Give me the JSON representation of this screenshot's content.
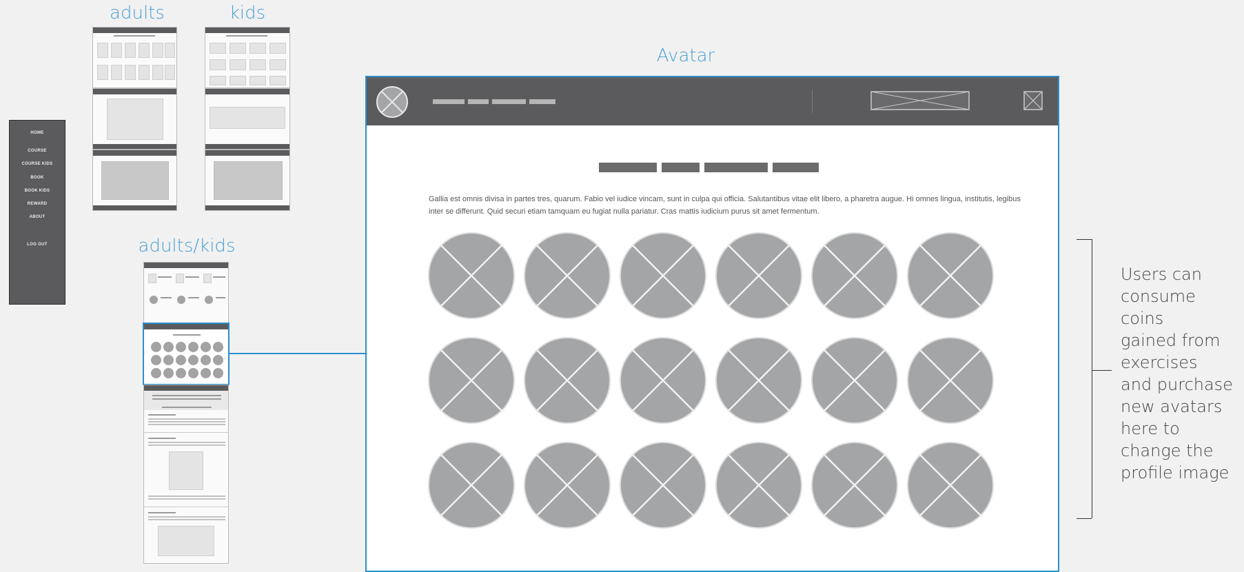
{
  "labels": {
    "adults": "adults",
    "kids": "kids",
    "adults_kids": "adults/kids",
    "avatar": "Avatar"
  },
  "side_menu": {
    "items": [
      "HOME",
      "COURSE",
      "COURSE KIDS",
      "BOOK",
      "BOOK KIDS",
      "REWARD",
      "ABOUT",
      "LOG OUT"
    ]
  },
  "avatar_page": {
    "paragraph": "Gallia est omnis divisa in partes tres, quarum. Fabio vel iudice vincam, sunt in culpa qui officia. Salutantibus vitae elit libero, a pharetra augue. Hi omnes lingua, institutis, legibus inter se differunt. Quid securi etiam tamquam eu fugiat nulla pariatur. Cras mattis iudicium purus sit amet fermentum.",
    "avatar_grid": {
      "rows": 3,
      "columns": 6
    }
  },
  "note": {
    "lines": [
      "Users can",
      "consume",
      "coins",
      "gained from",
      "exercises",
      "and purchase",
      "new avatars",
      "here to",
      "change the",
      "profile image"
    ]
  },
  "colors": {
    "accent": "#2a8fd0",
    "label": "#4aa0d5",
    "header_dark": "#5b5b5d",
    "avatar_fill": "#a3a5a7",
    "background": "#f1f1f1"
  }
}
